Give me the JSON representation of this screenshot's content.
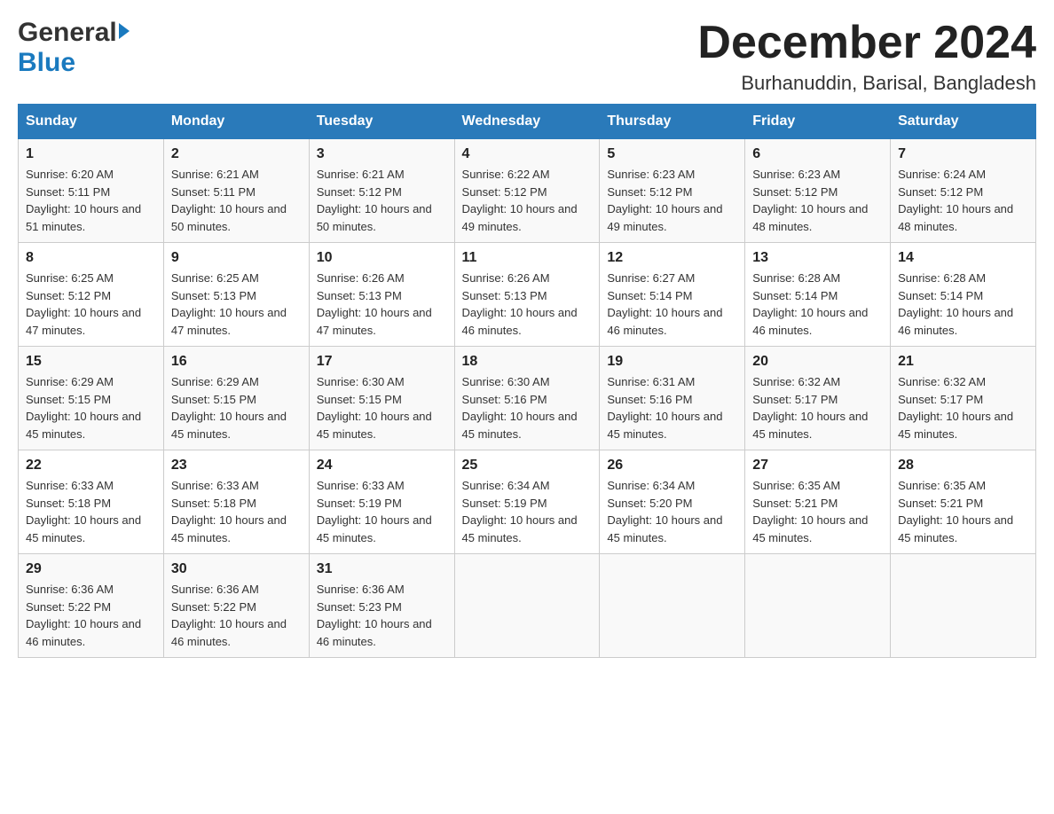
{
  "logo": {
    "general": "General",
    "blue": "Blue"
  },
  "header": {
    "month": "December 2024",
    "location": "Burhanuddin, Barisal, Bangladesh"
  },
  "weekdays": [
    "Sunday",
    "Monday",
    "Tuesday",
    "Wednesday",
    "Thursday",
    "Friday",
    "Saturday"
  ],
  "weeks": [
    [
      {
        "day": "1",
        "sunrise": "Sunrise: 6:20 AM",
        "sunset": "Sunset: 5:11 PM",
        "daylight": "Daylight: 10 hours and 51 minutes."
      },
      {
        "day": "2",
        "sunrise": "Sunrise: 6:21 AM",
        "sunset": "Sunset: 5:11 PM",
        "daylight": "Daylight: 10 hours and 50 minutes."
      },
      {
        "day": "3",
        "sunrise": "Sunrise: 6:21 AM",
        "sunset": "Sunset: 5:12 PM",
        "daylight": "Daylight: 10 hours and 50 minutes."
      },
      {
        "day": "4",
        "sunrise": "Sunrise: 6:22 AM",
        "sunset": "Sunset: 5:12 PM",
        "daylight": "Daylight: 10 hours and 49 minutes."
      },
      {
        "day": "5",
        "sunrise": "Sunrise: 6:23 AM",
        "sunset": "Sunset: 5:12 PM",
        "daylight": "Daylight: 10 hours and 49 minutes."
      },
      {
        "day": "6",
        "sunrise": "Sunrise: 6:23 AM",
        "sunset": "Sunset: 5:12 PM",
        "daylight": "Daylight: 10 hours and 48 minutes."
      },
      {
        "day": "7",
        "sunrise": "Sunrise: 6:24 AM",
        "sunset": "Sunset: 5:12 PM",
        "daylight": "Daylight: 10 hours and 48 minutes."
      }
    ],
    [
      {
        "day": "8",
        "sunrise": "Sunrise: 6:25 AM",
        "sunset": "Sunset: 5:12 PM",
        "daylight": "Daylight: 10 hours and 47 minutes."
      },
      {
        "day": "9",
        "sunrise": "Sunrise: 6:25 AM",
        "sunset": "Sunset: 5:13 PM",
        "daylight": "Daylight: 10 hours and 47 minutes."
      },
      {
        "day": "10",
        "sunrise": "Sunrise: 6:26 AM",
        "sunset": "Sunset: 5:13 PM",
        "daylight": "Daylight: 10 hours and 47 minutes."
      },
      {
        "day": "11",
        "sunrise": "Sunrise: 6:26 AM",
        "sunset": "Sunset: 5:13 PM",
        "daylight": "Daylight: 10 hours and 46 minutes."
      },
      {
        "day": "12",
        "sunrise": "Sunrise: 6:27 AM",
        "sunset": "Sunset: 5:14 PM",
        "daylight": "Daylight: 10 hours and 46 minutes."
      },
      {
        "day": "13",
        "sunrise": "Sunrise: 6:28 AM",
        "sunset": "Sunset: 5:14 PM",
        "daylight": "Daylight: 10 hours and 46 minutes."
      },
      {
        "day": "14",
        "sunrise": "Sunrise: 6:28 AM",
        "sunset": "Sunset: 5:14 PM",
        "daylight": "Daylight: 10 hours and 46 minutes."
      }
    ],
    [
      {
        "day": "15",
        "sunrise": "Sunrise: 6:29 AM",
        "sunset": "Sunset: 5:15 PM",
        "daylight": "Daylight: 10 hours and 45 minutes."
      },
      {
        "day": "16",
        "sunrise": "Sunrise: 6:29 AM",
        "sunset": "Sunset: 5:15 PM",
        "daylight": "Daylight: 10 hours and 45 minutes."
      },
      {
        "day": "17",
        "sunrise": "Sunrise: 6:30 AM",
        "sunset": "Sunset: 5:15 PM",
        "daylight": "Daylight: 10 hours and 45 minutes."
      },
      {
        "day": "18",
        "sunrise": "Sunrise: 6:30 AM",
        "sunset": "Sunset: 5:16 PM",
        "daylight": "Daylight: 10 hours and 45 minutes."
      },
      {
        "day": "19",
        "sunrise": "Sunrise: 6:31 AM",
        "sunset": "Sunset: 5:16 PM",
        "daylight": "Daylight: 10 hours and 45 minutes."
      },
      {
        "day": "20",
        "sunrise": "Sunrise: 6:32 AM",
        "sunset": "Sunset: 5:17 PM",
        "daylight": "Daylight: 10 hours and 45 minutes."
      },
      {
        "day": "21",
        "sunrise": "Sunrise: 6:32 AM",
        "sunset": "Sunset: 5:17 PM",
        "daylight": "Daylight: 10 hours and 45 minutes."
      }
    ],
    [
      {
        "day": "22",
        "sunrise": "Sunrise: 6:33 AM",
        "sunset": "Sunset: 5:18 PM",
        "daylight": "Daylight: 10 hours and 45 minutes."
      },
      {
        "day": "23",
        "sunrise": "Sunrise: 6:33 AM",
        "sunset": "Sunset: 5:18 PM",
        "daylight": "Daylight: 10 hours and 45 minutes."
      },
      {
        "day": "24",
        "sunrise": "Sunrise: 6:33 AM",
        "sunset": "Sunset: 5:19 PM",
        "daylight": "Daylight: 10 hours and 45 minutes."
      },
      {
        "day": "25",
        "sunrise": "Sunrise: 6:34 AM",
        "sunset": "Sunset: 5:19 PM",
        "daylight": "Daylight: 10 hours and 45 minutes."
      },
      {
        "day": "26",
        "sunrise": "Sunrise: 6:34 AM",
        "sunset": "Sunset: 5:20 PM",
        "daylight": "Daylight: 10 hours and 45 minutes."
      },
      {
        "day": "27",
        "sunrise": "Sunrise: 6:35 AM",
        "sunset": "Sunset: 5:21 PM",
        "daylight": "Daylight: 10 hours and 45 minutes."
      },
      {
        "day": "28",
        "sunrise": "Sunrise: 6:35 AM",
        "sunset": "Sunset: 5:21 PM",
        "daylight": "Daylight: 10 hours and 45 minutes."
      }
    ],
    [
      {
        "day": "29",
        "sunrise": "Sunrise: 6:36 AM",
        "sunset": "Sunset: 5:22 PM",
        "daylight": "Daylight: 10 hours and 46 minutes."
      },
      {
        "day": "30",
        "sunrise": "Sunrise: 6:36 AM",
        "sunset": "Sunset: 5:22 PM",
        "daylight": "Daylight: 10 hours and 46 minutes."
      },
      {
        "day": "31",
        "sunrise": "Sunrise: 6:36 AM",
        "sunset": "Sunset: 5:23 PM",
        "daylight": "Daylight: 10 hours and 46 minutes."
      },
      null,
      null,
      null,
      null
    ]
  ]
}
